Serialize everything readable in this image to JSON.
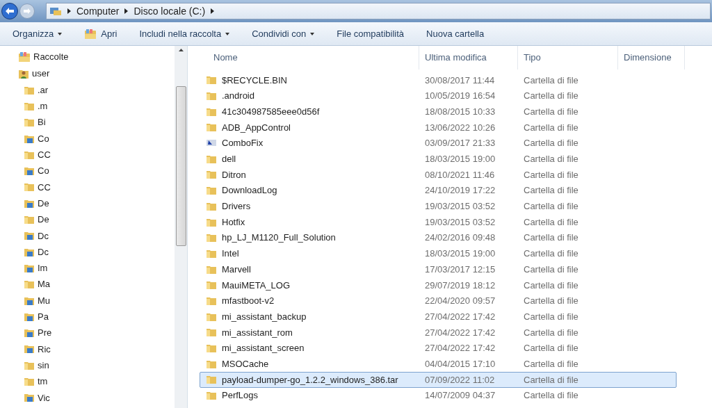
{
  "address_bar": {
    "crumbs": [
      "Computer",
      "Disco locale (C:)"
    ]
  },
  "toolbar": [
    {
      "label": "Organizza",
      "dropdown": true,
      "kind": "menu"
    },
    {
      "label": "Apri",
      "dropdown": false,
      "kind": "open"
    },
    {
      "label": "Includi nella raccolta",
      "dropdown": true,
      "kind": "menu"
    },
    {
      "label": "Condividi con",
      "dropdown": true,
      "kind": "menu"
    },
    {
      "label": "File compatibilità",
      "dropdown": false,
      "kind": "menu"
    },
    {
      "label": "Nuova cartella",
      "dropdown": false,
      "kind": "menu"
    }
  ],
  "sidebar": {
    "items": [
      {
        "label": "Raccolte",
        "kind": "library"
      },
      {
        "label": "user",
        "kind": "user",
        "children": [
          {
            "label": ".ar",
            "kind": "folder"
          },
          {
            "label": ".m",
            "kind": "folder"
          },
          {
            "label": "Bi",
            "kind": "folder"
          },
          {
            "label": "Co",
            "kind": "special"
          },
          {
            "label": "CC",
            "kind": "folder"
          },
          {
            "label": "Co",
            "kind": "special"
          },
          {
            "label": "CC",
            "kind": "folder"
          },
          {
            "label": "De",
            "kind": "special"
          },
          {
            "label": "De",
            "kind": "folder"
          },
          {
            "label": "Dc",
            "kind": "special"
          },
          {
            "label": "Dc",
            "kind": "special"
          },
          {
            "label": "Im",
            "kind": "special"
          },
          {
            "label": "Ma",
            "kind": "folder"
          },
          {
            "label": "Mu",
            "kind": "special"
          },
          {
            "label": "Pa",
            "kind": "special"
          },
          {
            "label": "Pre",
            "kind": "special"
          },
          {
            "label": "Ric",
            "kind": "special"
          },
          {
            "label": "sin",
            "kind": "folder"
          },
          {
            "label": "tm",
            "kind": "folder"
          },
          {
            "label": "Vic",
            "kind": "special"
          }
        ]
      }
    ]
  },
  "table": {
    "columns": [
      "Nome",
      "Ultima modifica",
      "Tipo",
      "Dimensione"
    ],
    "rows": [
      {
        "name": "$RECYCLE.BIN",
        "modified": "30/08/2017 11:44",
        "type": "Cartella di file",
        "kind": "folder",
        "selected": false
      },
      {
        "name": ".android",
        "modified": "10/05/2019 16:54",
        "type": "Cartella di file",
        "kind": "folder",
        "selected": false
      },
      {
        "name": "41c304987585eee0d56f",
        "modified": "18/08/2015 10:33",
        "type": "Cartella di file",
        "kind": "folder",
        "selected": false
      },
      {
        "name": "ADB_AppControl",
        "modified": "13/06/2022 10:26",
        "type": "Cartella di file",
        "kind": "folder",
        "selected": false
      },
      {
        "name": "ComboFix",
        "modified": "03/09/2017 21:33",
        "type": "Cartella di file",
        "kind": "program",
        "selected": false
      },
      {
        "name": "dell",
        "modified": "18/03/2015 19:00",
        "type": "Cartella di file",
        "kind": "folder",
        "selected": false
      },
      {
        "name": "Ditron",
        "modified": "08/10/2021 11:46",
        "type": "Cartella di file",
        "kind": "folder",
        "selected": false
      },
      {
        "name": "DownloadLog",
        "modified": "24/10/2019 17:22",
        "type": "Cartella di file",
        "kind": "folder",
        "selected": false
      },
      {
        "name": "Drivers",
        "modified": "19/03/2015 03:52",
        "type": "Cartella di file",
        "kind": "folder",
        "selected": false
      },
      {
        "name": "Hotfix",
        "modified": "19/03/2015 03:52",
        "type": "Cartella di file",
        "kind": "folder",
        "selected": false
      },
      {
        "name": "hp_LJ_M1120_Full_Solution",
        "modified": "24/02/2016 09:48",
        "type": "Cartella di file",
        "kind": "folder",
        "selected": false
      },
      {
        "name": "Intel",
        "modified": "18/03/2015 19:00",
        "type": "Cartella di file",
        "kind": "folder",
        "selected": false
      },
      {
        "name": "Marvell",
        "modified": "17/03/2017 12:15",
        "type": "Cartella di file",
        "kind": "folder",
        "selected": false
      },
      {
        "name": "MauiMETA_LOG",
        "modified": "29/07/2019 18:12",
        "type": "Cartella di file",
        "kind": "folder",
        "selected": false
      },
      {
        "name": "mfastboot-v2",
        "modified": "22/04/2020 09:57",
        "type": "Cartella di file",
        "kind": "folder",
        "selected": false
      },
      {
        "name": "mi_assistant_backup",
        "modified": "27/04/2022 17:42",
        "type": "Cartella di file",
        "kind": "folder",
        "selected": false
      },
      {
        "name": "mi_assistant_rom",
        "modified": "27/04/2022 17:42",
        "type": "Cartella di file",
        "kind": "folder",
        "selected": false
      },
      {
        "name": "mi_assistant_screen",
        "modified": "27/04/2022 17:42",
        "type": "Cartella di file",
        "kind": "folder",
        "selected": false
      },
      {
        "name": "MSOCache",
        "modified": "04/04/2015 17:10",
        "type": "Cartella di file",
        "kind": "folder",
        "selected": false
      },
      {
        "name": "payload-dumper-go_1.2.2_windows_386.tar",
        "modified": "07/09/2022 11:02",
        "type": "Cartella di file",
        "kind": "folder",
        "selected": true
      },
      {
        "name": "PerfLogs",
        "modified": "14/07/2009 04:37",
        "type": "Cartella di file",
        "kind": "folder",
        "selected": false
      }
    ]
  }
}
